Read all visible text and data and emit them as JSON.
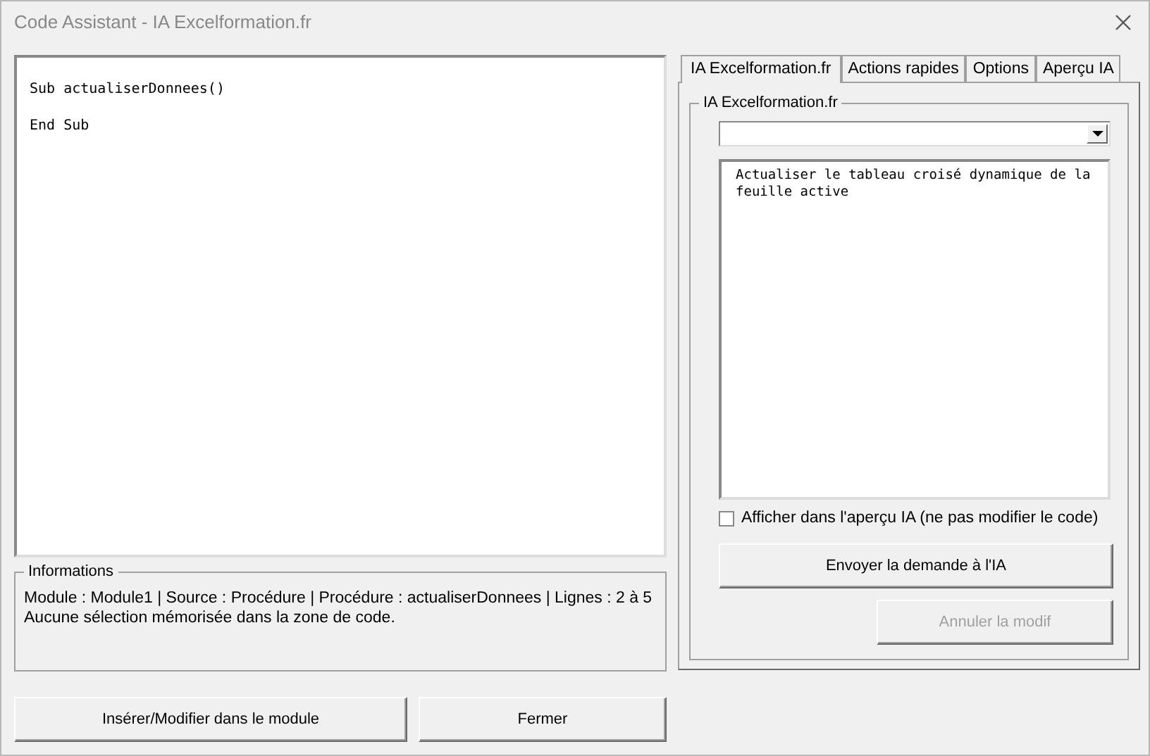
{
  "window": {
    "title": "Code Assistant - IA Excelformation.fr"
  },
  "code_editor": {
    "value": "Sub actualiserDonnees()\n\nEnd Sub"
  },
  "informations": {
    "label": "Informations",
    "lines": [
      "Module : Module1 | Source : Procédure | Procédure : actualiserDonnees | Lignes : 2 à 5",
      "Aucune sélection mémorisée dans la zone de code."
    ]
  },
  "bottom_buttons": [
    {
      "label": "Insérer/Modifier dans le module",
      "disabled": false
    },
    {
      "label": "Fermer",
      "disabled": false
    }
  ],
  "tabs": [
    {
      "label": "IA Excelformation.fr",
      "selected": true
    },
    {
      "label": "Actions rapides",
      "selected": false
    },
    {
      "label": "Options",
      "selected": false
    },
    {
      "label": "Aperçu IA",
      "selected": false
    }
  ],
  "ia_group": {
    "label": "IA Excelformation.fr",
    "prompt": "Actualiser le tableau croisé dynamique de la feuille active",
    "preview_checkbox": {
      "label": "Afficher dans l'aperçu IA (ne pas modifier le code)",
      "checked": false
    },
    "buttons": [
      {
        "label": "Envoyer la demande à l'IA",
        "disabled": false
      },
      {
        "label": "Annuler la modif",
        "disabled": true
      }
    ]
  }
}
